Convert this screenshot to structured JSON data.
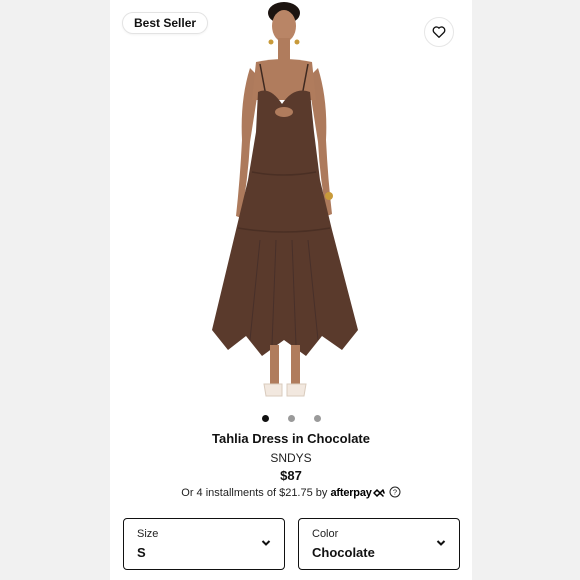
{
  "badge": "Best Seller",
  "product": {
    "title": "Tahlia Dress in Chocolate",
    "brand": "SNDYS",
    "price": "$87",
    "installments_prefix": "Or 4 installments of $21.75 by",
    "afterpay_label": "afterpay"
  },
  "gallery": {
    "image_count": 3,
    "active_index": 1
  },
  "size": {
    "label": "Size",
    "value": "S"
  },
  "color": {
    "label": "Color",
    "value": "Chocolate"
  },
  "colors": {
    "dress": "#5a3a2c",
    "background": "#ffffff",
    "page": "#f1f1f1"
  },
  "icons": {
    "wishlist": "heart-icon",
    "chevron": "chevron-down-icon",
    "help": "question-circle-icon",
    "afterpay": "afterpay-logo-icon"
  }
}
